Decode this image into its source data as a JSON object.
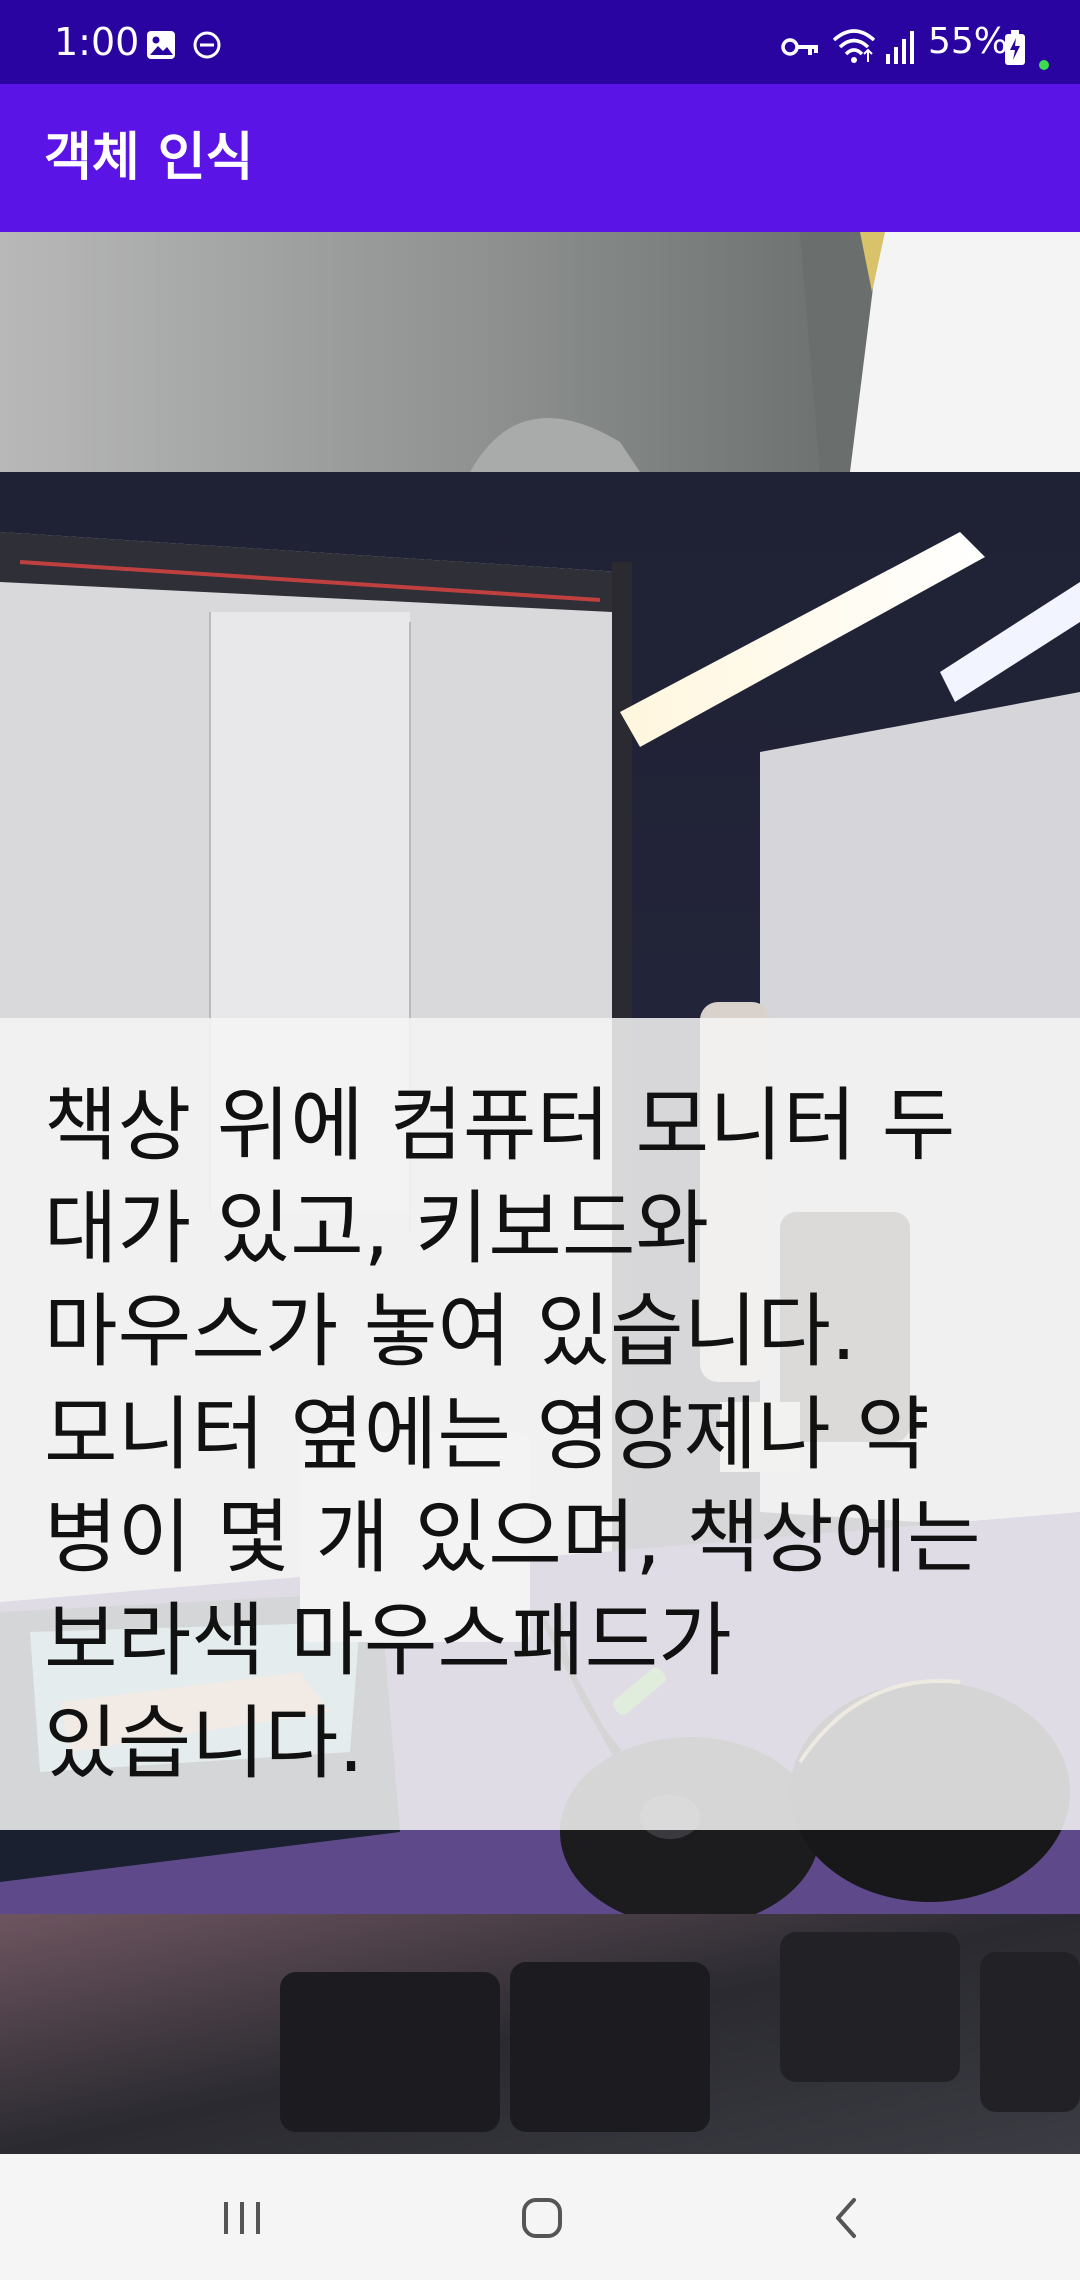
{
  "status_bar": {
    "time": "1:00",
    "battery": "55%",
    "icons": [
      "gallery-icon",
      "do-not-disturb-icon",
      "vpn-key-icon",
      "wifi-icon",
      "signal-icon",
      "battery-charging-icon"
    ]
  },
  "app_bar": {
    "title": "객체 인식"
  },
  "result": {
    "caption": "책상 위에 컴퓨터 모니터 두\n대가 있고, 키보드와\n마우스가 놓여 있습니다.\n모니터 옆에는 영양제나 약\n병이 몇 개 있으며, 책상에는\n보라색 마우스패드가\n있습니다."
  },
  "nav_bar": {
    "buttons": [
      "recent-apps",
      "home",
      "back"
    ]
  },
  "colors": {
    "status_bar": "#2a04a0",
    "app_bar": "#5a14e6",
    "caption_text": "#111111",
    "nav_bar": "#f5f5f5"
  }
}
